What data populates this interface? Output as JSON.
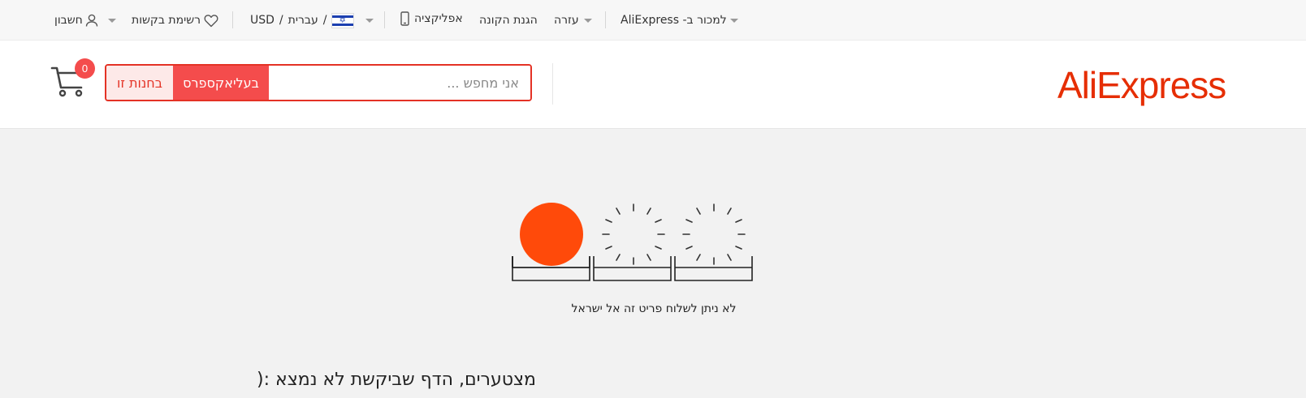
{
  "topbar": {
    "account_label": "חשבון",
    "wishlist_label": "רשימת בקשות",
    "currency": "USD",
    "language": "עברית",
    "separator": "/",
    "flag_glyph": "✡",
    "app_label": "אפליקציה",
    "buyer_protection_label": "הגנת הקונה",
    "help_label": "עזרה",
    "sell_label": "למכור ב- AliExpress",
    "icons": {
      "account": "user-icon",
      "wishlist": "heart-icon",
      "app": "phone-icon",
      "dropdown": "caret-down-icon"
    }
  },
  "header": {
    "logo_text": "AliExpress",
    "search": {
      "placeholder": "אני מחפש ...",
      "value": "",
      "search_aliexpress_label": "בעליאקספרס",
      "search_store_label": "בחנות זו"
    },
    "cart": {
      "count": "0",
      "icon": "cart-icon"
    }
  },
  "main": {
    "shipping_message": "לא ניתן לשלוח פריט זה אל ישראל",
    "not_found_message": "מצטערים, הדף שביקשת לא נמצא :("
  },
  "colors": {
    "brand": "#e62e04",
    "accent": "#f44c4c",
    "sun": "#ff4a0a",
    "background": "#f2f2f2"
  }
}
